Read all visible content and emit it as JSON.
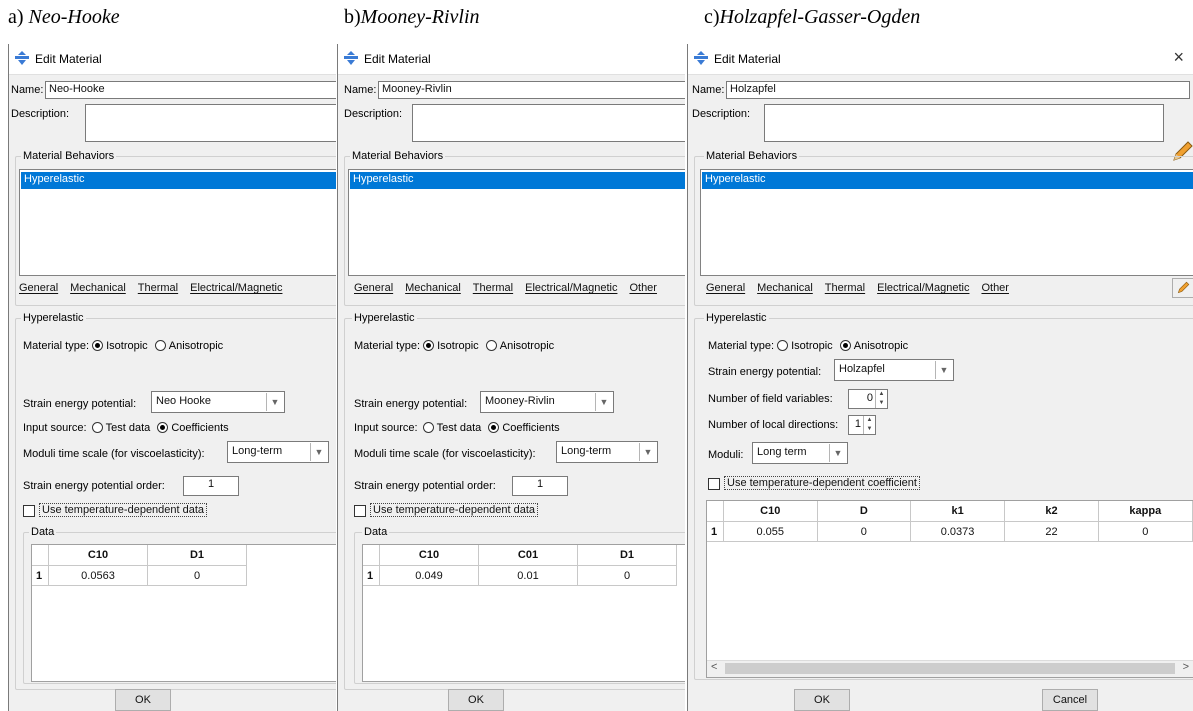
{
  "captions": [
    {
      "prefix": "a)",
      "name": "Neo-Hooke"
    },
    {
      "prefix": "b)",
      "name": "Mooney-Rivlin"
    },
    {
      "prefix": "c)",
      "name": "Holzapfel-Gasser-Ogden"
    }
  ],
  "common": {
    "title": "Edit Material",
    "close_glyph": "×",
    "name_label": "Name:",
    "description_label": "Description:",
    "material_behaviors": "Material Behaviors",
    "behavior": "Hyperelastic",
    "menu": [
      "General",
      "Mechanical",
      "Thermal",
      "Electrical/Magnetic",
      "Other"
    ],
    "section_title": "Hyperelastic",
    "material_type_label": "Material type:",
    "isotropic": "Isotropic",
    "anisotropic": "Anisotropic",
    "strain_energy_label": "Strain energy potential:",
    "input_source_label": "Input source:",
    "test_data": "Test data",
    "coefficients": "Coefficients",
    "moduli_timescale_label": "Moduli time scale (for viscoelasticity):",
    "strain_order_label": "Strain energy potential order:",
    "use_temp_data": "Use temperature-dependent data",
    "data_group": "Data",
    "ok": "OK",
    "cancel": "Cancel",
    "icons": {
      "title": "abaqus-material-icon",
      "edit": "pencil-icon"
    }
  },
  "dialogs": {
    "neo": {
      "name": "Neo-Hooke",
      "strain_energy": "Neo Hooke",
      "moduli_timescale": "Long-term",
      "order": "1",
      "columns": [
        "",
        "C10",
        "D1"
      ],
      "rows": [
        [
          "1",
          "0.0563",
          "0"
        ]
      ]
    },
    "mooney": {
      "name": "Mooney-Rivlin",
      "strain_energy": "Mooney-Rivlin",
      "moduli_timescale": "Long-term",
      "order": "1",
      "columns": [
        "",
        "C10",
        "C01",
        "D1"
      ],
      "rows": [
        [
          "1",
          "0.049",
          "0.01",
          "0"
        ]
      ]
    },
    "holz": {
      "name": "Holzapfel",
      "strain_energy": "Holzapfel",
      "field_vars_label": "Number of field variables:",
      "field_vars": "0",
      "local_dirs_label": "Number of local directions:",
      "local_dirs": "1",
      "moduli_label": "Moduli:",
      "moduli": "Long term",
      "use_temp_coef": "Use temperature-dependent coefficient",
      "columns": [
        "",
        "C10",
        "D",
        "k1",
        "k2",
        "kappa"
      ],
      "rows": [
        [
          "1",
          "0.055",
          "0",
          "0.0373",
          "22",
          "0"
        ]
      ]
    }
  }
}
